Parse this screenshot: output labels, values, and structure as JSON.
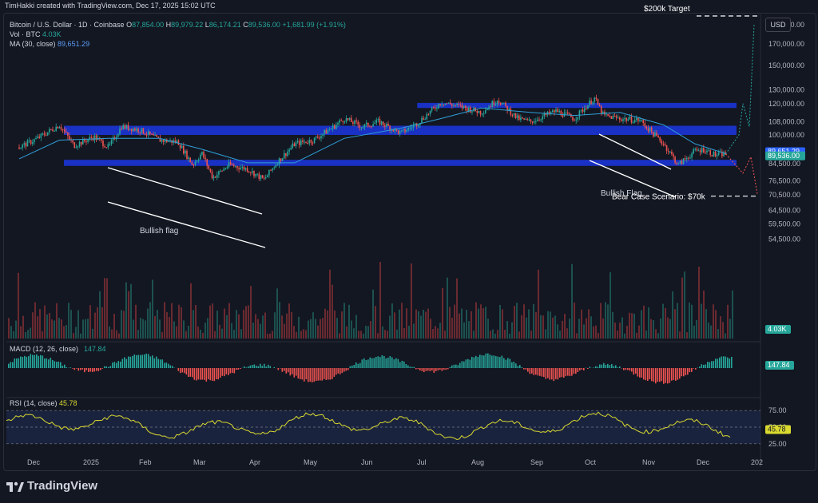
{
  "header": {
    "credit": "TimHakki created with TradingView.com, Dec 17, 2025 15:02 UTC"
  },
  "legend": {
    "symbol": "Bitcoin / U.S. Dollar · 1D · Coinbase",
    "open_label": "O",
    "open": "87,854.00",
    "high_label": "H",
    "high": "89,979.22",
    "low_label": "L",
    "low": "86,174.21",
    "close_label": "C",
    "close": "89,536.00",
    "change": "+1,681.99 (+1.91%)",
    "vol_label": "Vol · BTC",
    "vol": "4.03K",
    "ma_label": "MA (30, close)",
    "ma": "89,651.29"
  },
  "currency": "USD",
  "annotations": {
    "target": "$200k Target",
    "bear": "Bear Case Scenario: $70k",
    "flag1": "Bullish flag",
    "flag2": "Bullish Flag"
  },
  "macd": {
    "label": "MACD (12, 26, close)",
    "value": "147.84"
  },
  "rsi": {
    "label": "RSI (14, close)",
    "value": "45.78",
    "levels": [
      "75.00",
      "50.00",
      "25.00"
    ]
  },
  "colors": {
    "up": "#26a69a",
    "down": "#ef5350",
    "ma": "#2f9fd6",
    "zone": "#1b34d6",
    "rsi": "#d9d92f",
    "bg": "#131722"
  },
  "footer": {
    "brand": "TradingView"
  },
  "chart_data": {
    "type": "line",
    "title": "Bitcoin / U.S. Dollar · 1D · Coinbase",
    "x_tick_labels": [
      "Dec",
      "2025",
      "Feb",
      "Mar",
      "Apr",
      "May",
      "Jun",
      "Jul",
      "Aug",
      "Sep",
      "Oct",
      "Nov",
      "Dec",
      "202"
    ],
    "y_tick_labels": [
      "190,000.00",
      "170,000.00",
      "150,000.00",
      "130,000.00",
      "120,000.00",
      "108,000.00",
      "100,000.00",
      "84,500.00",
      "76,500.00",
      "70,500.00",
      "64,500.00",
      "59,500.00",
      "54,500.00"
    ],
    "y_scale": "log",
    "price_labels": [
      "89,651.29",
      "89,536.00"
    ],
    "price_label_colors": [
      "#2962ff",
      "#26a69a"
    ],
    "volume_label": "4.03K",
    "series": [
      {
        "name": "BTCUSD",
        "x": [
          "2024-11-25",
          "2024-12-05",
          "2024-12-17",
          "2024-12-25",
          "2025-01-05",
          "2025-01-13",
          "2025-01-20",
          "2025-01-30",
          "2025-02-10",
          "2025-02-20",
          "2025-02-28",
          "2025-03-05",
          "2025-03-11",
          "2025-03-20",
          "2025-03-30",
          "2025-04-08",
          "2025-04-15",
          "2025-04-25",
          "2025-05-05",
          "2025-05-15",
          "2025-05-22",
          "2025-06-01",
          "2025-06-10",
          "2025-06-22",
          "2025-07-01",
          "2025-07-14",
          "2025-07-25",
          "2025-08-05",
          "2025-08-14",
          "2025-08-25",
          "2025-09-01",
          "2025-09-15",
          "2025-09-25",
          "2025-10-06",
          "2025-10-11",
          "2025-10-20",
          "2025-10-31",
          "2025-11-07",
          "2025-11-13",
          "2025-11-21",
          "2025-11-30",
          "2025-12-05",
          "2025-12-11",
          "2025-12-17"
        ],
        "close": [
          93000,
          98000,
          106000,
          94000,
          99000,
          93000,
          105000,
          103000,
          97000,
          96000,
          84000,
          90000,
          78000,
          84000,
          82000,
          77000,
          85000,
          95000,
          97000,
          104000,
          110000,
          105000,
          108000,
          101000,
          107000,
          121000,
          118000,
          114000,
          123000,
          110000,
          108000,
          115000,
          110000,
          124000,
          112000,
          110000,
          109000,
          101000,
          95000,
          84000,
          91000,
          92000,
          89000,
          89536
        ]
      },
      {
        "name": "MA (30, close)",
        "x": [
          "2024-11-25",
          "2024-12-17",
          "2025-01-13",
          "2025-02-10",
          "2025-03-05",
          "2025-03-30",
          "2025-04-25",
          "2025-05-22",
          "2025-06-22",
          "2025-07-14",
          "2025-08-05",
          "2025-09-01",
          "2025-09-25",
          "2025-10-20",
          "2025-11-13",
          "2025-11-30",
          "2025-12-17"
        ],
        "close": [
          87000,
          97000,
          98000,
          98000,
          92000,
          85000,
          85000,
          98000,
          104000,
          110000,
          117000,
          114000,
          112000,
          114000,
          106000,
          95000,
          89651
        ]
      }
    ],
    "zones": [
      {
        "from": 100000,
        "to": 105500
      },
      {
        "from": 117000,
        "to": 120500
      },
      {
        "from": 83500,
        "to": 86500
      }
    ],
    "levels": [
      {
        "label": "$200k Target",
        "value": 200000
      },
      {
        "label": "Bear Case Scenario: $70k",
        "value": 70000
      }
    ],
    "ylim": [
      50000,
      200000
    ]
  }
}
